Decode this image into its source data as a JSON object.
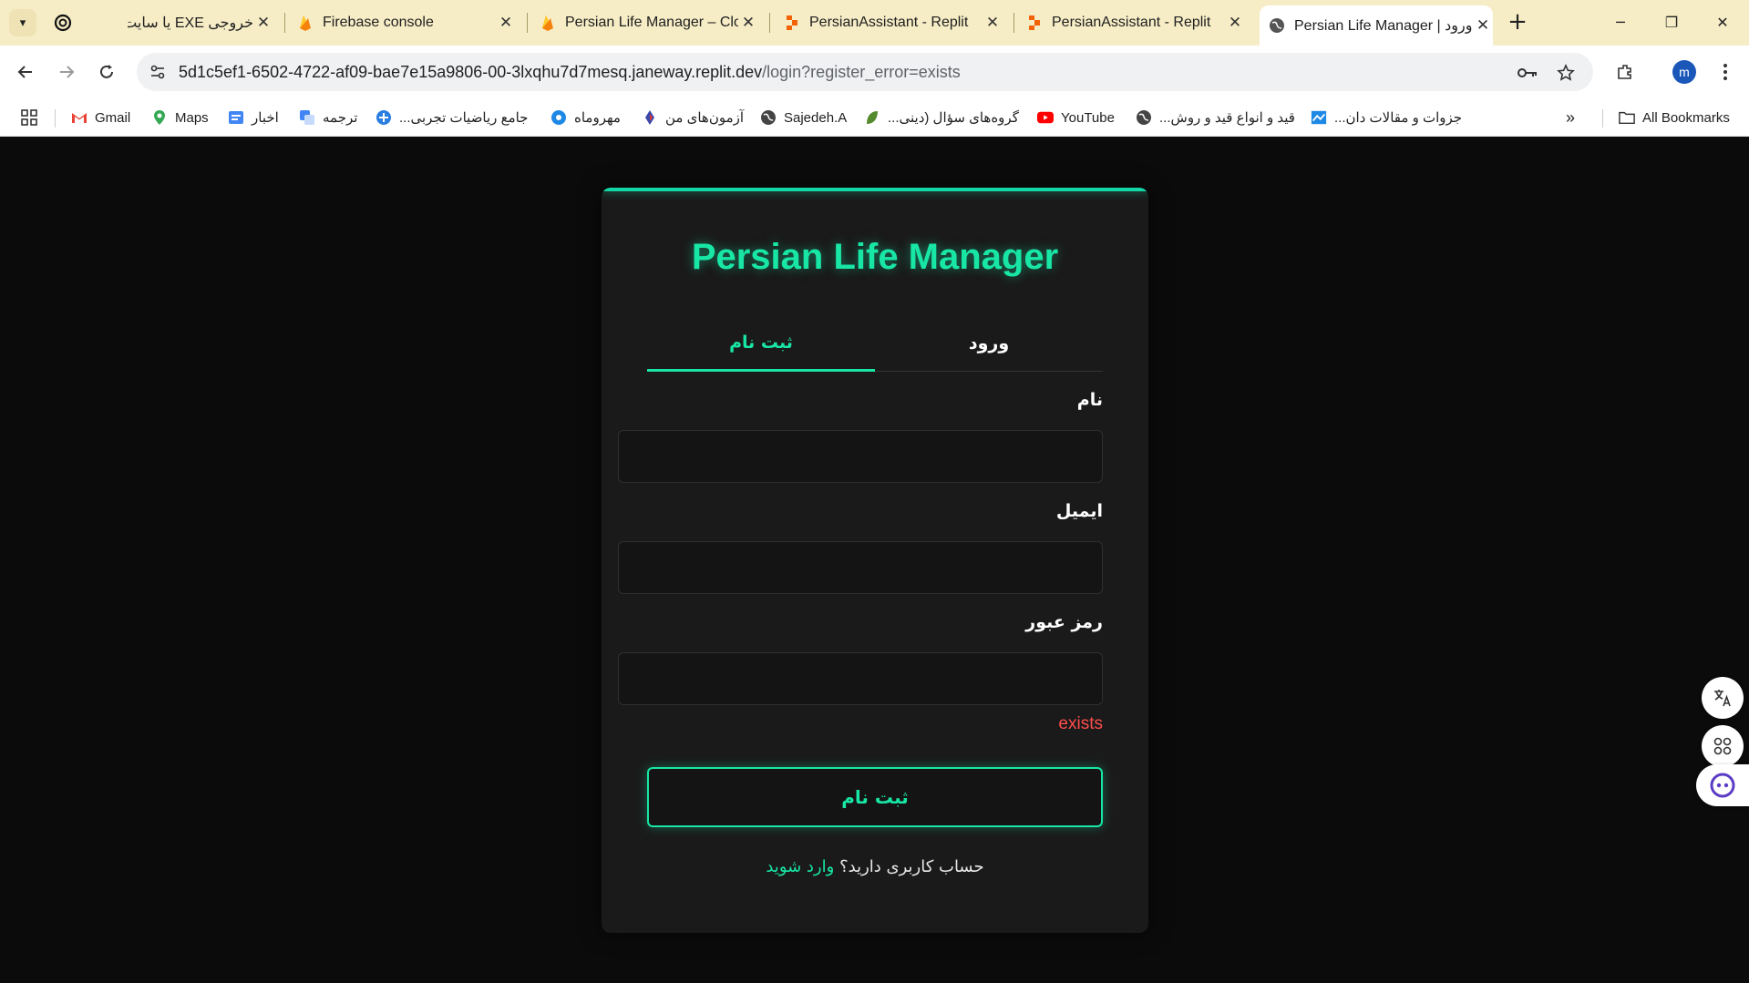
{
  "browser": {
    "tabs": [
      {
        "title": "خروجی EXE یا سایت",
        "icon": "chatgpt-icon"
      },
      {
        "title": "Firebase console",
        "icon": "firebase-icon"
      },
      {
        "title": "Persian Life Manager – Clo",
        "icon": "firebase-icon"
      },
      {
        "title": "PersianAssistant - Replit",
        "icon": "replit-icon"
      },
      {
        "title": "PersianAssistant - Replit",
        "icon": "replit-icon"
      },
      {
        "title": "Persian Life Manager | ورود",
        "icon": "globe-icon",
        "active": true
      }
    ],
    "url_host": "5d1c5ef1-6502-4722-af09-bae7e15a9806-00-3lxqhu7d7mesq.janeway.replit.dev",
    "url_path": "/login?register_error=exists",
    "profile_initial": "m",
    "bookmarks": [
      {
        "label": "Gmail",
        "icon": "gmail-icon"
      },
      {
        "label": "Maps",
        "icon": "maps-icon"
      },
      {
        "label": "اخبار",
        "icon": "news-icon"
      },
      {
        "label": "ترجمه",
        "icon": "translate-icon"
      },
      {
        "label": "جامع ریاضیات تجربی...",
        "icon": "site-icon"
      },
      {
        "label": "مهروماه",
        "icon": "site-icon"
      },
      {
        "label": "آزمون‌های من",
        "icon": "site-icon"
      },
      {
        "label": "Sajedeh.A",
        "icon": "globe-icon"
      },
      {
        "label": "گروه‌های سؤال (دینی...",
        "icon": "leaf-icon"
      },
      {
        "label": "YouTube",
        "icon": "youtube-icon"
      },
      {
        "label": "قید و انواع قید و روش...",
        "icon": "globe-icon"
      },
      {
        "label": "جزوات و مقالات دان...",
        "icon": "site-icon"
      }
    ],
    "all_bookmarks_label": "All Bookmarks",
    "colors": {
      "tabbar": "#f6edc6",
      "accent": "#18e6a5"
    }
  },
  "app": {
    "title": "Persian Life Manager",
    "tab_register": "ثبت نام",
    "tab_login": "ورود",
    "label_name": "نام",
    "label_email": "ایمیل",
    "label_password": "رمز عبور",
    "name_value": "",
    "email_value": "",
    "password_value": "",
    "error_text": "exists",
    "submit_label": "ثبت نام",
    "footer_question": "حساب کاربری دارید؟",
    "footer_link": "وارد شوید",
    "colors": {
      "accent": "#18e6a5",
      "error": "#ff4d4d",
      "card": "#1a1a1a",
      "background": "#0b0b0b"
    }
  }
}
